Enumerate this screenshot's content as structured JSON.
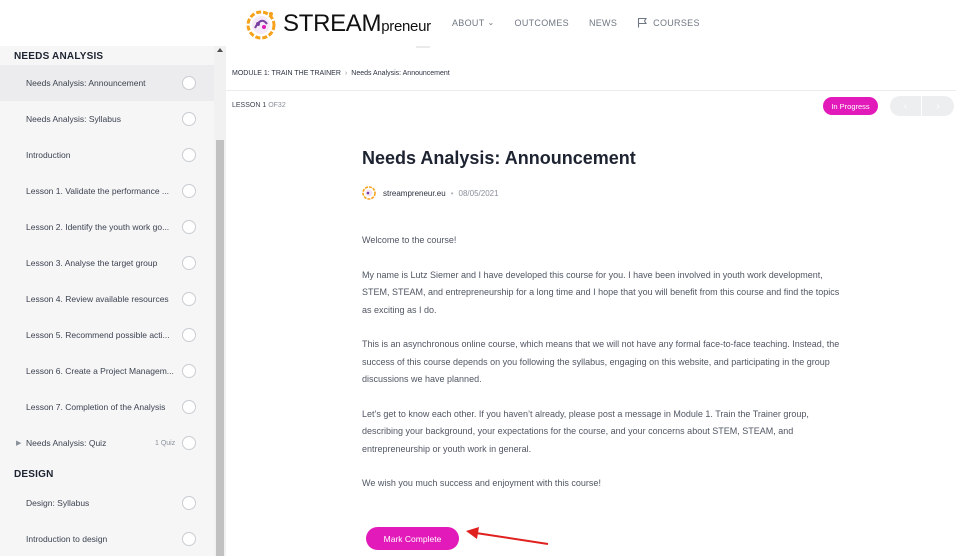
{
  "header": {
    "brand": "STREAM",
    "brand_suffix": "preneur",
    "nav": [
      {
        "label": "ABOUT",
        "has_dropdown": true
      },
      {
        "label": "OUTCOMES"
      },
      {
        "label": "NEWS"
      },
      {
        "label": "COURSES",
        "icon": "flag-icon"
      }
    ]
  },
  "sidebar": {
    "sections": [
      {
        "title": "NEEDS ANALYSIS",
        "items": [
          {
            "label": "Needs Analysis: Announcement",
            "active": true
          },
          {
            "label": "Needs Analysis: Syllabus"
          },
          {
            "label": "Introduction"
          },
          {
            "label": "Lesson 1. Validate the performance ..."
          },
          {
            "label": "Lesson 2. Identify the youth work go..."
          },
          {
            "label": "Lesson 3. Analyse the target group"
          },
          {
            "label": "Lesson 4. Review available resources"
          },
          {
            "label": "Lesson 5. Recommend possible acti..."
          },
          {
            "label": "Lesson 6. Create a Project Managem..."
          },
          {
            "label": "Lesson 7. Completion of the Analysis"
          },
          {
            "label": "Needs Analysis: Quiz",
            "count": "1 Quiz"
          }
        ]
      },
      {
        "title": "DESIGN",
        "items": [
          {
            "label": "Design: Syllabus"
          },
          {
            "label": "Introduction to design"
          }
        ]
      }
    ]
  },
  "main": {
    "breadcrumb": [
      "MODULE 1: TRAIN THE TRAINER",
      "Needs Analysis: Announcement"
    ],
    "lesson_prefix": "LESSON 1",
    "lesson_suffix": "OF32",
    "status": "In Progress",
    "prev_arrow": "‹",
    "next_arrow": "›",
    "title": "Needs Analysis: Announcement",
    "author": "streampreneur.eu",
    "date": "08/05/2021",
    "paragraphs": [
      "Welcome to the course!",
      "My name is Lutz Siemer and I have developed this course for you. I have been involved in youth work development, STEM, STEAM, and entrepreneurship for a long time and I hope that you will benefit from this course and find the topics as exciting as I do.",
      "This is an asynchronous online course, which means that we will not have any formal face-to-face teaching. Instead, the success of this course depends on you following the syllabus, engaging on this website, and participating in the group discussions we have planned.",
      "Let’s get to know each other. If you haven’t already, please post a message in Module 1. Train the Trainer group, describing your background, your expectations for the course, and your concerns about STEM, STEAM, and entrepreneurship or youth work in general.",
      "We wish you much success and enjoyment with this course!"
    ],
    "mark_complete": "Mark Complete"
  },
  "colors": {
    "accent": "#e21ab9",
    "annotation_arrow": "#e0201e"
  }
}
